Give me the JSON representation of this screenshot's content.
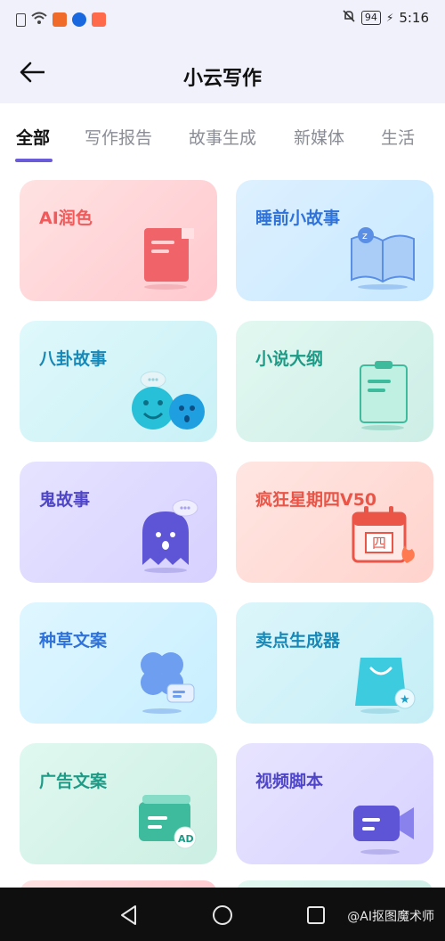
{
  "status": {
    "battery": "94",
    "time": "5:16"
  },
  "header": {
    "title": "小云写作"
  },
  "tabs": [
    {
      "label": "全部",
      "active": true
    },
    {
      "label": "写作报告",
      "active": false
    },
    {
      "label": "故事生成",
      "active": false
    },
    {
      "label": "新媒体",
      "active": false
    },
    {
      "label": "生活",
      "active": false
    }
  ],
  "cards": [
    {
      "label": "AI润色",
      "icon": "document-icon",
      "color": "#f05a5a"
    },
    {
      "label": "睡前小故事",
      "icon": "open-book-icon",
      "color": "#2f72d9"
    },
    {
      "label": "八卦故事",
      "icon": "emoji-faces-icon",
      "color": "#1789b8"
    },
    {
      "label": "小说大纲",
      "icon": "clipboard-icon",
      "color": "#1d9b86"
    },
    {
      "label": "鬼故事",
      "icon": "ghost-icon",
      "color": "#4f45c9"
    },
    {
      "label": "疯狂星期四V50",
      "icon": "calendar-icon",
      "color": "#ea5548"
    },
    {
      "label": "种草文案",
      "icon": "clover-icon",
      "color": "#2f72d9"
    },
    {
      "label": "卖点生成器",
      "icon": "shopping-bag-icon",
      "color": "#1789b8"
    },
    {
      "label": "广告文案",
      "icon": "ad-card-icon",
      "color": "#1d9b86"
    },
    {
      "label": "视频脚本",
      "icon": "video-camera-icon",
      "color": "#4f45c9"
    }
  ],
  "illustrations": {
    "calendar_day": "四",
    "ad_badge": "AD"
  },
  "watermark": "@AI抠图魔术师"
}
